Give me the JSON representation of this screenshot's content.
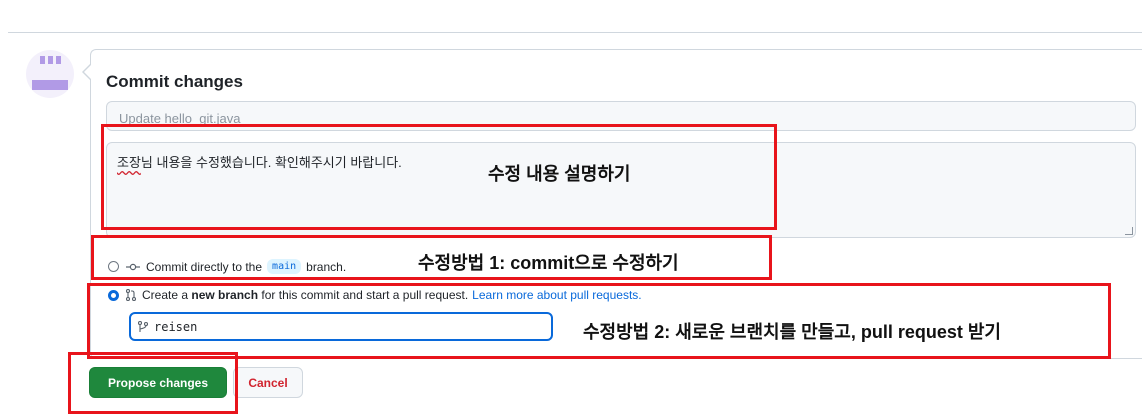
{
  "form": {
    "title": "Commit changes",
    "summary_placeholder": "Update hello_git.java",
    "description_value": "님  내용을 수정했습니다. 확인해주시기 바랍니다.",
    "description_name": "조장",
    "options": {
      "direct": {
        "prefix": "Commit directly to the",
        "branch": "main",
        "suffix": "branch."
      },
      "new_branch": {
        "prefix": "Create a",
        "bold": "new branch",
        "suffix": "for this commit and start a pull request.",
        "link": "Learn more about pull requests."
      }
    },
    "branch_name": "reisen"
  },
  "buttons": {
    "propose": "Propose changes",
    "cancel": "Cancel"
  },
  "annotations": {
    "description_note": "수정 내용 설명하기",
    "method1_note": "수정방법 1: commit으로 수정하기",
    "method2_note": "수정방법 2: 새로운 브랜치를 만들고, pull request 받기"
  },
  "colors": {
    "primary_button": "#1f883d",
    "link": "#0969da",
    "annotation_box": "#e8141b"
  },
  "icons": [
    "commit-icon",
    "pull-request-icon",
    "branch-icon",
    "avatar-identicon"
  ]
}
